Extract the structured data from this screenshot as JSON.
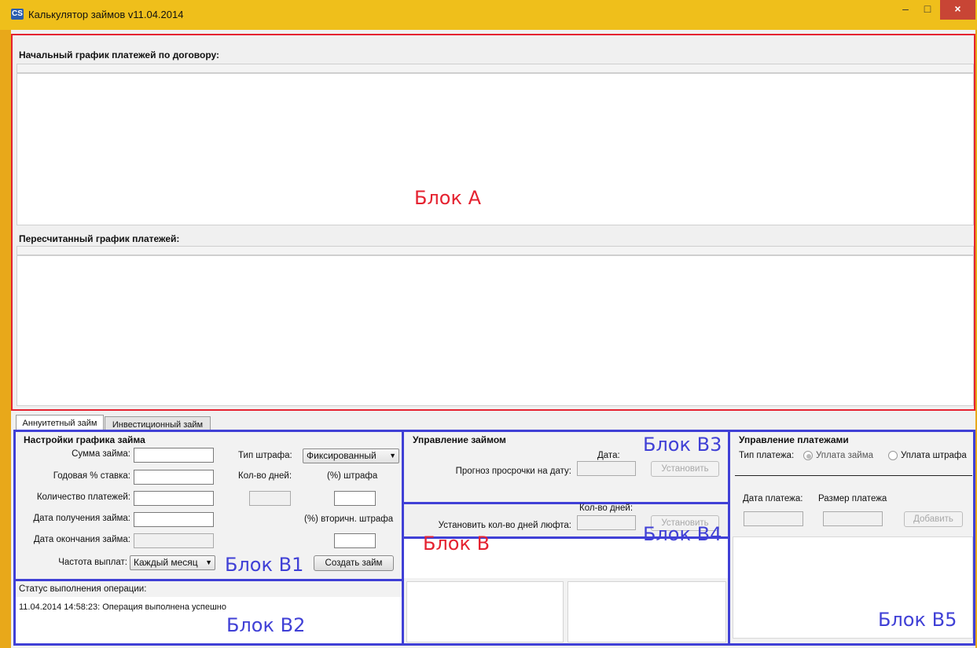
{
  "window": {
    "icon_text": "CS",
    "title": "Калькулятор займов v11.04.2014",
    "minimize": "–",
    "maximize": "□",
    "close": "×"
  },
  "block_a": {
    "initial_schedule_label": "Начальный график платежей по договору:",
    "recalculated_schedule_label": "Пересчитанный график платежей:",
    "annotation": "Блок А"
  },
  "tabs": [
    "Аннуитетный займ",
    "Инвестиционный займ"
  ],
  "b1": {
    "title": "Настройки графика займа",
    "loan_amount_label": "Сумма займа:",
    "loan_amount_value": "",
    "annual_rate_label": "Годовая % ставка:",
    "payments_count_label": "Количество платежей:",
    "receive_date_label": "Дата получения займа:",
    "end_date_label": "Дата окончания займа:",
    "frequency_label": "Частота выплат:",
    "frequency_value": "Каждый месяц",
    "penalty_type_label": "Тип штрафа:",
    "penalty_type_value": "Фиксированный",
    "days_count_label": "Кол-во дней:",
    "penalty_percent_label": "(%) штрафа",
    "secondary_penalty_label": "(%) вторичн. штрафа",
    "create_button": "Создать займ",
    "annotation": "Блок В1"
  },
  "b2": {
    "status_header": "Статус выполнения операции:",
    "status_message": "11.04.2014 14:58:23: Операция выполнена успешно",
    "annotation": "Блок В2"
  },
  "b3": {
    "title": "Управление займом",
    "date_label": "Дата:",
    "forecast_label": "Прогноз просрочки на дату:",
    "set_button_1": "Установить",
    "days_label": "Кол-во дней:",
    "grace_days_label": "Установить кол-во дней люфта:",
    "set_button_2": "Установить",
    "annotation": "Блок В3"
  },
  "b_main": {
    "annotation": "Блок В"
  },
  "b4": {
    "annotation": "Блок В4"
  },
  "b5": {
    "title": "Управление платежами",
    "payment_type_label": "Тип платежа:",
    "option_loan": "Уплата займа",
    "option_penalty": "Уплата штрафа",
    "payment_date_label": "Дата платежа:",
    "payment_amount_label": "Размер платежа",
    "add_button": "Добавить",
    "annotation": "Блок В5"
  },
  "colors": {
    "titlebar": "#efbf1b",
    "annotation_red": "#e52230",
    "annotation_blue": "#4040d6",
    "close_button": "#c84535"
  }
}
